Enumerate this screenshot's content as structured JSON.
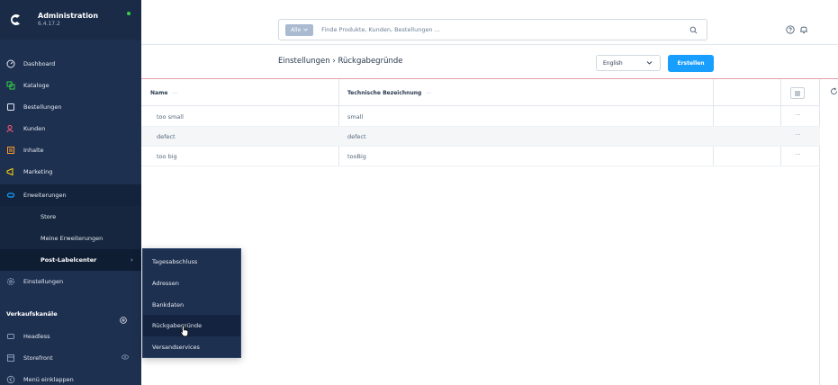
{
  "app": {
    "name": "Administration",
    "version": "6.4.17.2"
  },
  "sidebar": {
    "items": [
      {
        "label": "Dashboard"
      },
      {
        "label": "Kataloge"
      },
      {
        "label": "Bestellungen"
      },
      {
        "label": "Kunden"
      },
      {
        "label": "Inhalte"
      },
      {
        "label": "Marketing"
      },
      {
        "label": "Erweiterungen"
      },
      {
        "label": "Einstellungen"
      }
    ],
    "sub_items": [
      {
        "label": "Store"
      },
      {
        "label": "Meine Erweiterungen"
      },
      {
        "label": "Post-Labelcenter"
      }
    ],
    "sales_channels_title": "Verkaufskanäle",
    "sales_channels": [
      {
        "label": "Headless"
      },
      {
        "label": "Storefront"
      }
    ],
    "collapse_label": "Menü einklappen"
  },
  "flyout": {
    "items": [
      {
        "label": "Tagesabschluss"
      },
      {
        "label": "Adressen"
      },
      {
        "label": "Bankdaten"
      },
      {
        "label": "Rückgabegründe"
      },
      {
        "label": "Versandservices"
      }
    ]
  },
  "search": {
    "type_label": "Alle",
    "placeholder": "Finde Produkte, Kunden, Bestellungen ..."
  },
  "smartbar": {
    "breadcrumb_parent": "Einstellungen",
    "breadcrumb_sep": "›",
    "breadcrumb_current": "Rückgabegründe",
    "language": "English",
    "create_label": "Erstellen"
  },
  "grid": {
    "columns": [
      "Name",
      "Technische Bezeichnung"
    ],
    "rows": [
      {
        "name": "too small",
        "technical_name": "small",
        "actions": "···"
      },
      {
        "name": "defect",
        "technical_name": "defect",
        "actions": "···"
      },
      {
        "name": "too big",
        "technical_name": "tooBig",
        "actions": "···"
      }
    ],
    "header_dash": "—"
  },
  "colors": {
    "sidebar": "#1e3050",
    "accent": "#189eff",
    "active_dot": "#37d046"
  }
}
